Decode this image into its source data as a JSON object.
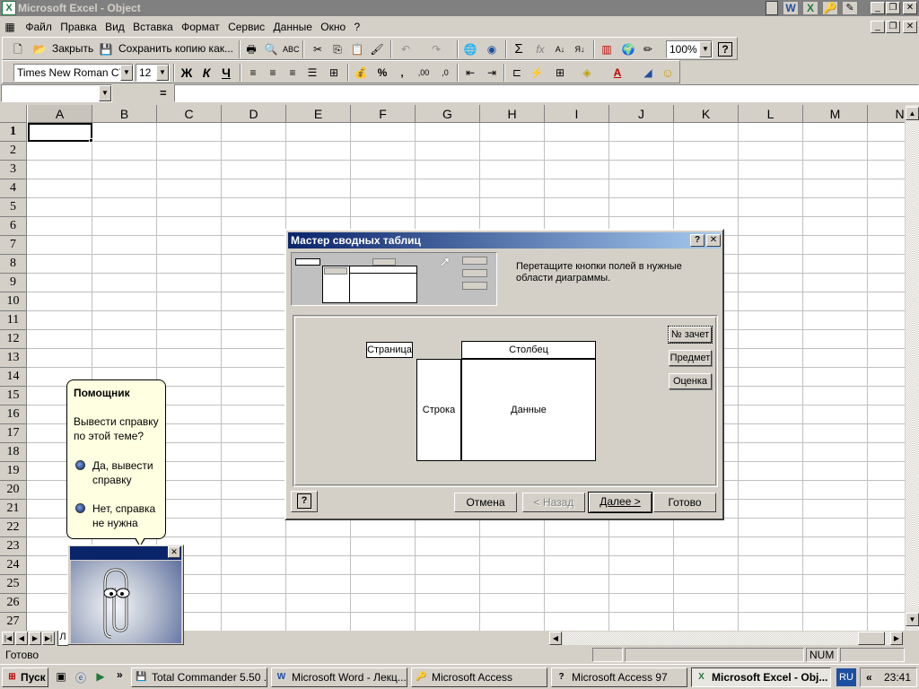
{
  "app": {
    "title": "Microsoft Excel - Object",
    "icon": "excel-icon"
  },
  "menu": [
    "Файл",
    "Правка",
    "Вид",
    "Вставка",
    "Формат",
    "Сервис",
    "Данные",
    "Окно",
    "?"
  ],
  "toolbar1": {
    "close_label": "Закрыть",
    "save_copy_label": "Сохранить копию как...",
    "zoom": "100%"
  },
  "toolbar2": {
    "font": "Times New Roman CYR",
    "size": "12",
    "bold": "Ж",
    "italic": "К",
    "underline": "Ч",
    "percent": "%",
    "comma": ","
  },
  "formula": {
    "name_box": "",
    "equals": "="
  },
  "grid": {
    "columns": [
      "A",
      "B",
      "C",
      "D",
      "E",
      "F",
      "G",
      "H",
      "I",
      "J",
      "K",
      "L",
      "M",
      "N"
    ],
    "rows": [
      "1",
      "2",
      "3",
      "4",
      "5",
      "6",
      "7",
      "8",
      "9",
      "10",
      "11",
      "12",
      "13",
      "14",
      "15",
      "16",
      "17",
      "18",
      "19",
      "20",
      "21",
      "22",
      "23",
      "24",
      "25",
      "26",
      "27"
    ]
  },
  "dialog": {
    "title": "Мастер сводных таблиц",
    "help_btn": "?",
    "close_btn": "✕",
    "instruction": "Перетащите кнопки полей в нужные области диаграммы.",
    "areas": {
      "page": "Страница",
      "column": "Столбец",
      "row": "Строка",
      "data": "Данные"
    },
    "fields": [
      "№ зачет",
      "Предмет",
      "Оценка"
    ],
    "buttons": {
      "cancel": "Отмена",
      "back": "< Назад",
      "next": "Далее >",
      "finish": "Готово"
    }
  },
  "assistant": {
    "title": "Помощник",
    "question": "Вывести справку по этой теме?",
    "option_yes": "Да, вывести справку",
    "option_no": "Нет, справка не нужна"
  },
  "sheet_tab_partial": "Л",
  "status": {
    "ready": "Готово",
    "num": "NUM"
  },
  "taskbar": {
    "start": "Пуск",
    "tasks": [
      "Total Commander 5.50 ...",
      "Microsoft Word - Лекц...",
      "Microsoft Access",
      "Microsoft Access 97",
      "Microsoft Excel - Obj..."
    ],
    "lang": "RU",
    "clock": "23:41"
  }
}
